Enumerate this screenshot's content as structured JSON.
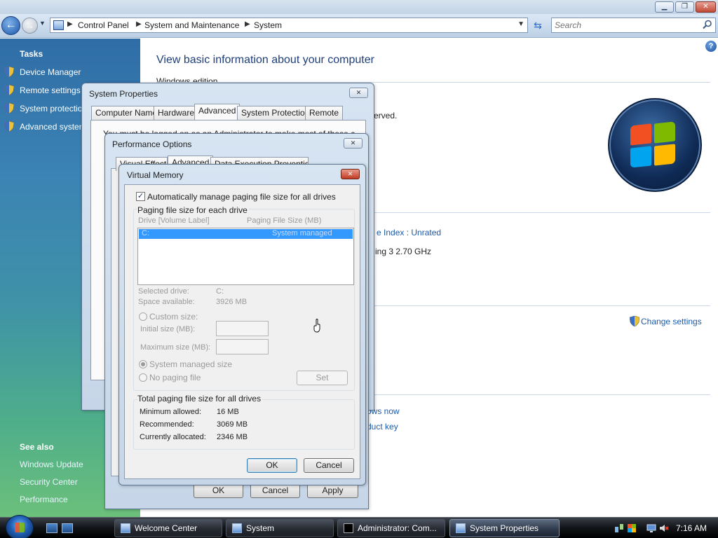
{
  "window": {
    "minimize": "▁",
    "maximize": "❐",
    "close": "✕"
  },
  "navbar": {
    "breadcrumbs": [
      "Control Panel",
      "System and Maintenance",
      "System"
    ],
    "search_placeholder": "Search"
  },
  "taskpane": {
    "tasks_heading": "Tasks",
    "tasks": [
      "Device Manager",
      "Remote settings",
      "System protection",
      "Advanced system settings"
    ],
    "see_also_heading": "See also",
    "see_also": [
      "Windows Update",
      "Security Center",
      "Performance"
    ]
  },
  "content": {
    "title": "View basic information about your computer",
    "edition_heading": "Windows edition",
    "frag_reserved": "erved.",
    "frag_index": "e Index : Unrated",
    "frag_processor": "ing 3   2.70 GHz",
    "change_settings": "Change settings",
    "frag_activate": "ows now",
    "frag_product_key": "duct key"
  },
  "system_properties": {
    "title": "System Properties",
    "tabs": [
      "Computer Name",
      "Hardware",
      "Advanced",
      "System Protection",
      "Remote"
    ],
    "active_tab": "Advanced",
    "frag_text": "You must be logged on as an Administrator to make most of these changes."
  },
  "performance_options": {
    "title": "Performance Options",
    "tabs": [
      "Visual Effects",
      "Advanced",
      "Data Execution Prevention"
    ],
    "buttons": {
      "ok": "OK",
      "cancel": "Cancel",
      "apply": "Apply"
    }
  },
  "virtual_memory": {
    "title": "Virtual Memory",
    "auto_manage_label": "Automatically manage paging file size for all drives",
    "auto_manage_checked": true,
    "each_drive_heading": "Paging file size for each drive",
    "col_drive": "Drive  [Volume Label]",
    "col_size": "Paging File Size (MB)",
    "drive_row": {
      "drive": "C:",
      "size": "System managed"
    },
    "selected_drive_label": "Selected drive:",
    "selected_drive_value": "C:",
    "space_available_label": "Space available:",
    "space_available_value": "3926 MB",
    "custom_size_label": "Custom size:",
    "initial_size_label": "Initial size (MB):",
    "maximum_size_label": "Maximum size (MB):",
    "system_managed_label": "System managed size",
    "no_paging_label": "No paging file",
    "set_button": "Set",
    "totals_heading": "Total paging file size for all drives",
    "min_allowed_label": "Minimum allowed:",
    "min_allowed_value": "16 MB",
    "recommended_label": "Recommended:",
    "recommended_value": "3069 MB",
    "allocated_label": "Currently allocated:",
    "allocated_value": "2346 MB",
    "ok": "OK",
    "cancel": "Cancel"
  },
  "taskbar": {
    "buttons": [
      "Welcome Center",
      "System",
      "Administrator: Com...",
      "System Properties"
    ],
    "active_button": "System Properties",
    "clock": "7:16 AM"
  },
  "colors": {
    "title_blue": "#1e3e7a",
    "link_blue": "#1c5aa8",
    "selection_blue": "#3399ff"
  }
}
